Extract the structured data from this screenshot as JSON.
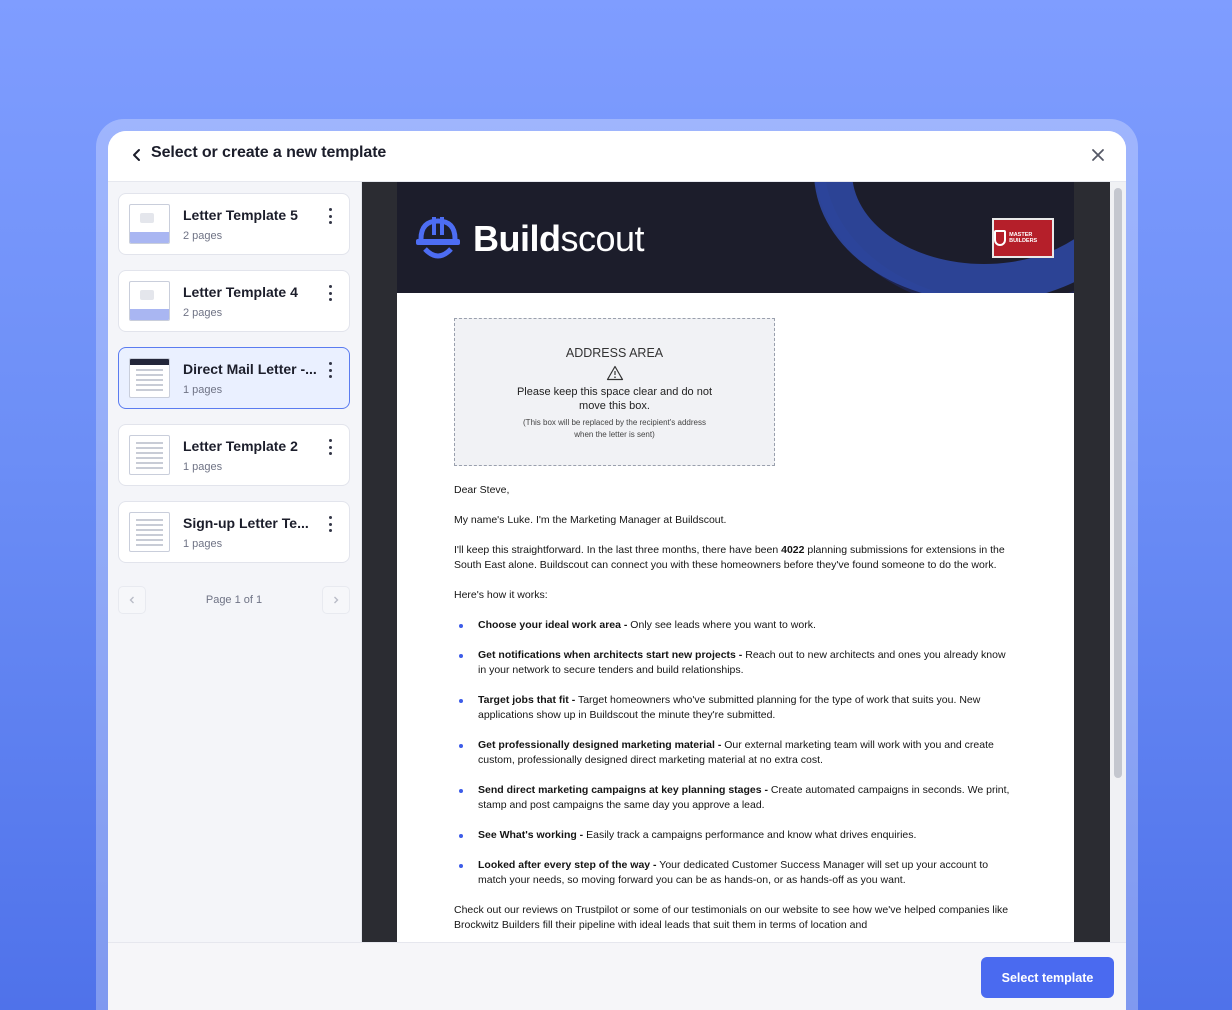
{
  "modal": {
    "title": "Select or create a new template",
    "footer": {
      "select_label": "Select template"
    }
  },
  "sidebar": {
    "templates": [
      {
        "name": "Letter Template 5",
        "pages": "2 pages",
        "selected": false
      },
      {
        "name": "Letter Template 4",
        "pages": "2 pages",
        "selected": false
      },
      {
        "name": "Direct Mail Letter -...",
        "pages": "1 pages",
        "selected": true
      },
      {
        "name": "Letter Template 2",
        "pages": "1 pages",
        "selected": false
      },
      {
        "name": "Sign-up Letter Te...",
        "pages": "1 pages",
        "selected": false
      }
    ],
    "pager": {
      "text": "Page 1 of 1"
    }
  },
  "letter": {
    "brand_bold": "Build",
    "brand_light": "scout",
    "badge_text": "MASTER BUILDERS",
    "address": {
      "title": "ADDRESS AREA",
      "line1": "Please keep this space clear and do not move this box.",
      "line2": "(This box will be replaced by the recipient's address when the letter is sent)"
    },
    "greeting": "Dear Steve,",
    "intro": "My name's Luke. I'm the Marketing Manager at Buildscout.",
    "para1_a": "I'll keep this straightforward. In the last three months, there have been ",
    "para1_count": "4022",
    "para1_b": " planning submissions for extensions in the South East alone. Buildscout can connect you with these homeowners before they've found someone to do the work.",
    "how_it_works": "Here's how it works:",
    "bullets": [
      {
        "title": "Choose your ideal work area -",
        "text": " Only see leads where you want to work."
      },
      {
        "title": "Get notifications when architects start new projects -",
        "text": " Reach out to new architects and ones you already know in your network to secure tenders and build relationships."
      },
      {
        "title": "Target jobs that fit -",
        "text": " Target homeowners who've submitted planning for the type of work that suits you. New applications show up in Buildscout the minute they're submitted."
      },
      {
        "title": "Get professionally designed marketing material -",
        "text": " Our external marketing team will work with you and create custom, professionally designed direct marketing material at no extra cost."
      },
      {
        "title": "Send direct marketing campaigns at key planning stages -",
        "text": " Create automated campaigns in seconds. We print, stamp and post campaigns the same day you approve a lead."
      },
      {
        "title": "See What's working -",
        "text": " Easily track a campaigns performance and know what drives enquiries."
      },
      {
        "title": "Looked after every step of the way -",
        "text": " Your dedicated Customer Success Manager will set up your account to match your needs, so moving forward you can be as hands-on, or as hands-off as you want."
      }
    ],
    "closing": "Check out our reviews on Trustpilot or some of our testimonials on our website to see how we've helped companies like Brockwitz Builders fill their pipeline with ideal leads that suit them in terms of location and"
  },
  "colors": {
    "accent": "#4a6af0",
    "header_dark": "#1c1d2b",
    "badge_red": "#b51f2a"
  },
  "icons": {
    "back": "chevron-left-icon",
    "close": "close-icon",
    "kebab": "kebab-menu-icon",
    "warn": "warning-triangle-icon"
  }
}
